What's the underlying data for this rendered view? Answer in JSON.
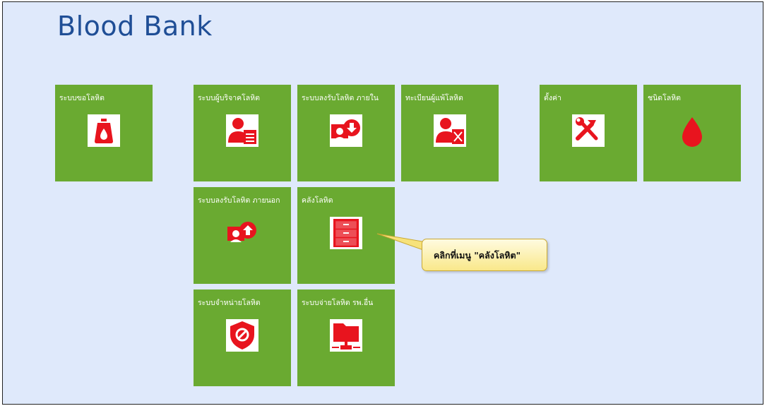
{
  "app": {
    "title": "Blood Bank"
  },
  "tiles": {
    "request": {
      "label": "ระบบขอโลหิต"
    },
    "donor": {
      "label": "ระบบผู้บริจาคโลหิต"
    },
    "receive_internal": {
      "label": "ระบบลงรับโลหิต ภายใน"
    },
    "allergy_registry": {
      "label": "ทะเบียนผู้แพ้โลหิต"
    },
    "settings": {
      "label": "ตั้งค่า"
    },
    "blood_type": {
      "label": "ชนิดโลหิต"
    },
    "receive_external": {
      "label": "ระบบลงรับโลหิต ภายนอก"
    },
    "inventory": {
      "label": "คลังโลหิต"
    },
    "disposal": {
      "label": "ระบบจำหน่ายโลหิต"
    },
    "dispense_other_hospital": {
      "label": "ระบบจ่ายโลหิต รพ.อื่น"
    }
  },
  "callout": {
    "text": "คลิกที่เมนู \"คลังโลหิต\""
  },
  "colors": {
    "tile": "#6aaa31",
    "icon_bg": "#ffffff",
    "icon": "#e8141e",
    "title": "#1f4e96",
    "background": "#dfe9fb"
  },
  "icons": {
    "request": "blood-bag-icon",
    "donor": "donor-document-icon",
    "receive_internal": "receive-internal-icon",
    "allergy_registry": "allergy-person-icon",
    "settings": "tools-icon",
    "blood_type": "blood-drop-icon",
    "receive_external": "receive-external-icon",
    "inventory": "cabinet-icon",
    "disposal": "prohibited-icon",
    "dispense_other_hospital": "network-folder-icon"
  }
}
